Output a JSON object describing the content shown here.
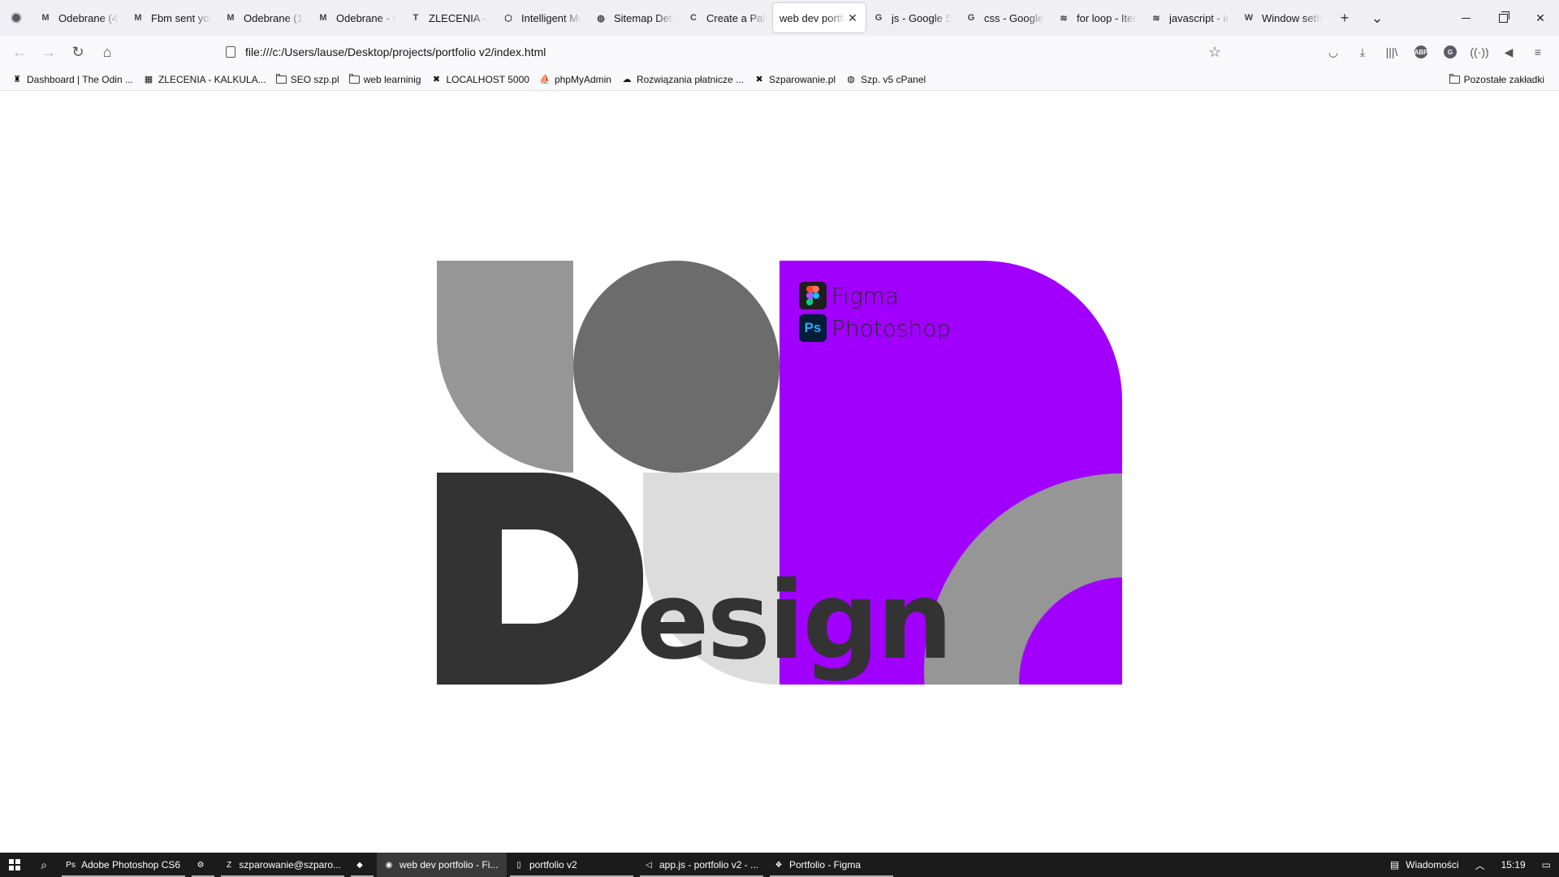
{
  "browser": {
    "tabs": [
      {
        "title": "Odebrane (4)",
        "icon": "M"
      },
      {
        "title": "Fbm sent you",
        "icon": "M"
      },
      {
        "title": "Odebrane (15",
        "icon": "M"
      },
      {
        "title": "Odebrane - s",
        "icon": "M"
      },
      {
        "title": "ZLECENIA - K",
        "icon": "T"
      },
      {
        "title": "Intelligent Mo",
        "icon": "⬡"
      },
      {
        "title": "Sitemap Deta",
        "icon": "◍"
      },
      {
        "title": "Create a Palet",
        "icon": "C"
      },
      {
        "title": "web dev portfo",
        "icon": "",
        "active": true
      },
      {
        "title": "js - Google Se",
        "icon": "G"
      },
      {
        "title": "css - Google S",
        "icon": "G"
      },
      {
        "title": "for loop - Iter",
        "icon": "≋"
      },
      {
        "title": "javascript - in",
        "icon": "≋"
      },
      {
        "title": "Window setIn",
        "icon": "W"
      }
    ],
    "new_tab_icon": "+",
    "list_tabs_icon": "⌄",
    "url": "file:///c:/Users/lause/Desktop/projects/portfolio v2/index.html"
  },
  "bookmarks": {
    "items": [
      {
        "label": "Dashboard | The Odin ...",
        "icon": "odin-icon"
      },
      {
        "label": "ZLECENIA - KALKULA...",
        "icon": "trello-icon"
      },
      {
        "label": "SEO szp.pl",
        "icon": "folder-icon"
      },
      {
        "label": "web learninig",
        "icon": "folder-icon"
      },
      {
        "label": "LOCALHOST 5000",
        "icon": "szp-icon"
      },
      {
        "label": "phpMyAdmin",
        "icon": "phpmyadmin-icon"
      },
      {
        "label": "Rozwiązania płatnicze ...",
        "icon": "cloud-icon"
      },
      {
        "label": "Szparowanie.pl",
        "icon": "szp-icon"
      },
      {
        "label": "Szp. v5 cPanel",
        "icon": "globe-icon"
      }
    ],
    "other": "Pozostałe zakładki"
  },
  "page": {
    "tools": [
      {
        "label": "Figma",
        "icon": "figma-icon"
      },
      {
        "label": "Photoshop",
        "icon": "photoshop-icon",
        "icon_text": "Ps"
      }
    ],
    "big_letter": "D",
    "word": "esign",
    "colors": {
      "purple": "#a100ff",
      "gray": "#969696",
      "dark_gray": "#6c6c6c",
      "charcoal": "#333333",
      "light_gray": "#dcdcdc"
    }
  },
  "taskbar": {
    "items": [
      {
        "label": "Adobe Photoshop CS6",
        "icon": "photoshop-icon",
        "state": "open"
      },
      {
        "label": "",
        "icon": "settings-icon",
        "state": "open"
      },
      {
        "label": "szparowanie@szparo...",
        "icon": "filezilla-icon",
        "state": "open"
      },
      {
        "label": "",
        "icon": "brave-icon",
        "state": "open"
      },
      {
        "label": "web dev portfolio - Fi...",
        "icon": "firefox-icon",
        "state": "active"
      },
      {
        "label": "portfolio v2",
        "icon": "explorer-icon",
        "state": "open"
      },
      {
        "label": "app.js - portfolio v2 - ...",
        "icon": "vscode-icon",
        "state": "open"
      },
      {
        "label": "Portfolio - Figma",
        "icon": "figma-icon",
        "state": "open"
      }
    ],
    "news": "Wiadomości",
    "time": "15:19"
  }
}
